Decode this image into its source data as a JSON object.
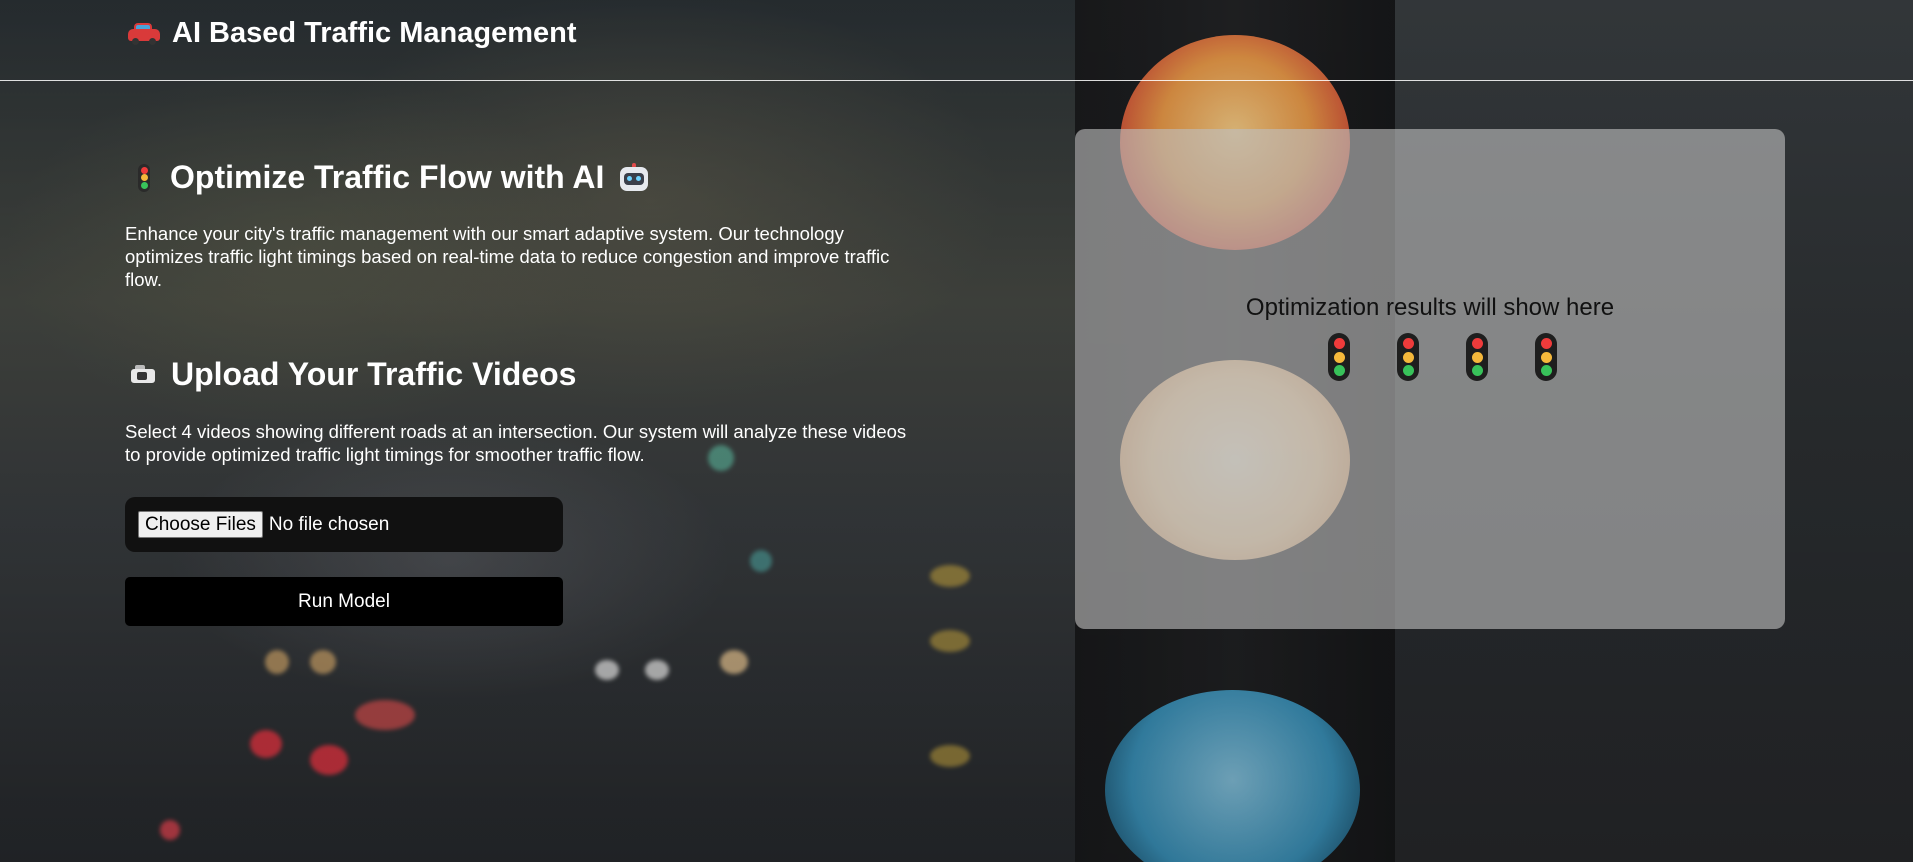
{
  "header": {
    "icon": "car-icon",
    "title": "AI Based Traffic Management"
  },
  "intro": {
    "heading_icon": "traffic-light-icon",
    "heading": "Optimize Traffic Flow with AI",
    "heading_trailing_icon": "robot-icon",
    "description": "Enhance your city's traffic management with our smart adaptive system. Our technology optimizes traffic light timings based on real-time data to reduce congestion and improve traffic flow."
  },
  "upload": {
    "heading_icon": "camera-icon",
    "heading": "Upload Your Traffic Videos",
    "description": "Select 4 videos showing different roads at an intersection. Our system will analyze these videos to provide optimized traffic light timings for smoother traffic flow.",
    "file_button_label": "Choose Files",
    "file_status": "No file chosen",
    "run_button_label": "Run Model"
  },
  "results": {
    "placeholder": "Optimization results will show here",
    "signal_icons": [
      "traffic-light-icon",
      "traffic-light-icon",
      "traffic-light-icon",
      "traffic-light-icon"
    ]
  },
  "colors": {
    "panel_bg": "#bebebe",
    "button_bg": "#000000",
    "file_bg": "#111111",
    "text": "#ffffff"
  }
}
